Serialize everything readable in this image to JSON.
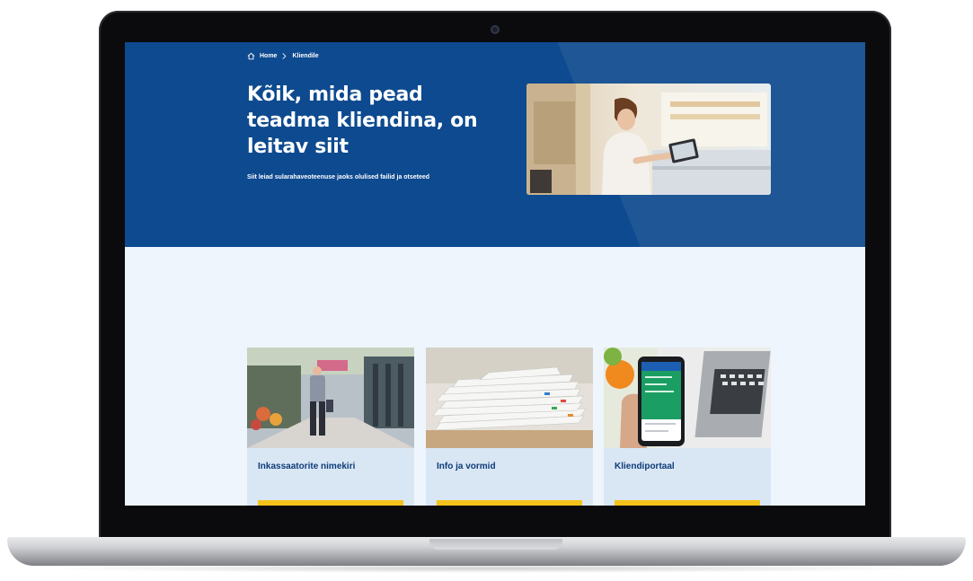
{
  "breadcrumb": {
    "home": "Home",
    "current": "Kliendile"
  },
  "hero": {
    "title": "Kõik, mida pead teadma kliendina, on leitav siit",
    "subtitle": "Siit leiad sularahaveoteenuse jaoks olulised failid ja otseteed"
  },
  "cards": [
    {
      "title": "Inkassaatorite nimekiri"
    },
    {
      "title": "Info ja vormid"
    },
    {
      "title": "Kliendiportaal"
    }
  ],
  "colors": {
    "hero_bg": "#0d4a8f",
    "page_bg": "#eef5fc",
    "card_bg": "#d9e6f4",
    "card_title": "#0d3c78",
    "button": "#f5c21b"
  },
  "icons": [
    "home-icon",
    "chevron-right-icon"
  ]
}
